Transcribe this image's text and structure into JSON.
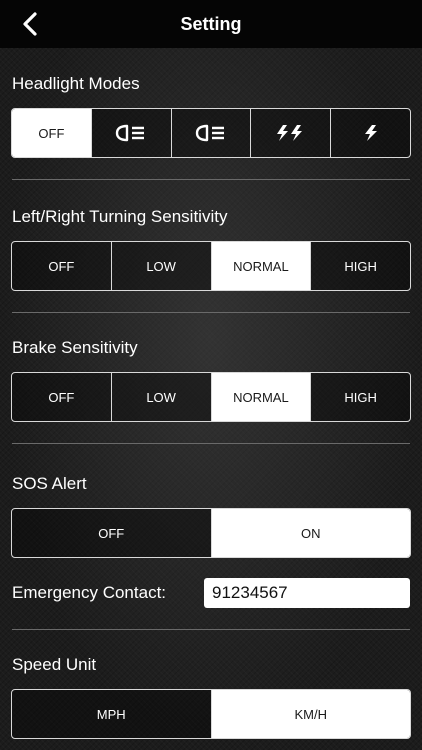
{
  "nav": {
    "title": "Setting",
    "back_icon": "chevron-left-icon"
  },
  "headlight": {
    "title": "Headlight Modes",
    "options": [
      {
        "label": "OFF",
        "icon": null,
        "selected": true
      },
      {
        "label": "",
        "icon": "low-beam-icon",
        "selected": false
      },
      {
        "label": "",
        "icon": "high-beam-icon",
        "selected": false
      },
      {
        "label": "",
        "icon": "double-flash-icon",
        "selected": false
      },
      {
        "label": "",
        "icon": "single-flash-icon",
        "selected": false
      }
    ]
  },
  "turning": {
    "title": "Left/Right Turning Sensitivity",
    "options": [
      {
        "label": "OFF",
        "selected": false
      },
      {
        "label": "LOW",
        "selected": false
      },
      {
        "label": "NORMAL",
        "selected": true
      },
      {
        "label": "HIGH",
        "selected": false
      }
    ]
  },
  "brake": {
    "title": "Brake Sensitivity",
    "options": [
      {
        "label": "OFF",
        "selected": false
      },
      {
        "label": "LOW",
        "selected": false
      },
      {
        "label": "NORMAL",
        "selected": true
      },
      {
        "label": "HIGH",
        "selected": false
      }
    ]
  },
  "sos": {
    "title": "SOS Alert",
    "options": [
      {
        "label": "OFF",
        "selected": false
      },
      {
        "label": "ON",
        "selected": true
      }
    ]
  },
  "contact": {
    "label": "Emergency Contact:",
    "value": "91234567"
  },
  "speed": {
    "title": "Speed Unit",
    "options": [
      {
        "label": "MPH",
        "selected": false
      },
      {
        "label": "KM/H",
        "selected": true
      }
    ]
  },
  "colors": {
    "selected_bg": "#ffffff",
    "selected_text": "#1a1a1a",
    "border": "#d9d9d9",
    "navbar_bg": "#050505"
  }
}
